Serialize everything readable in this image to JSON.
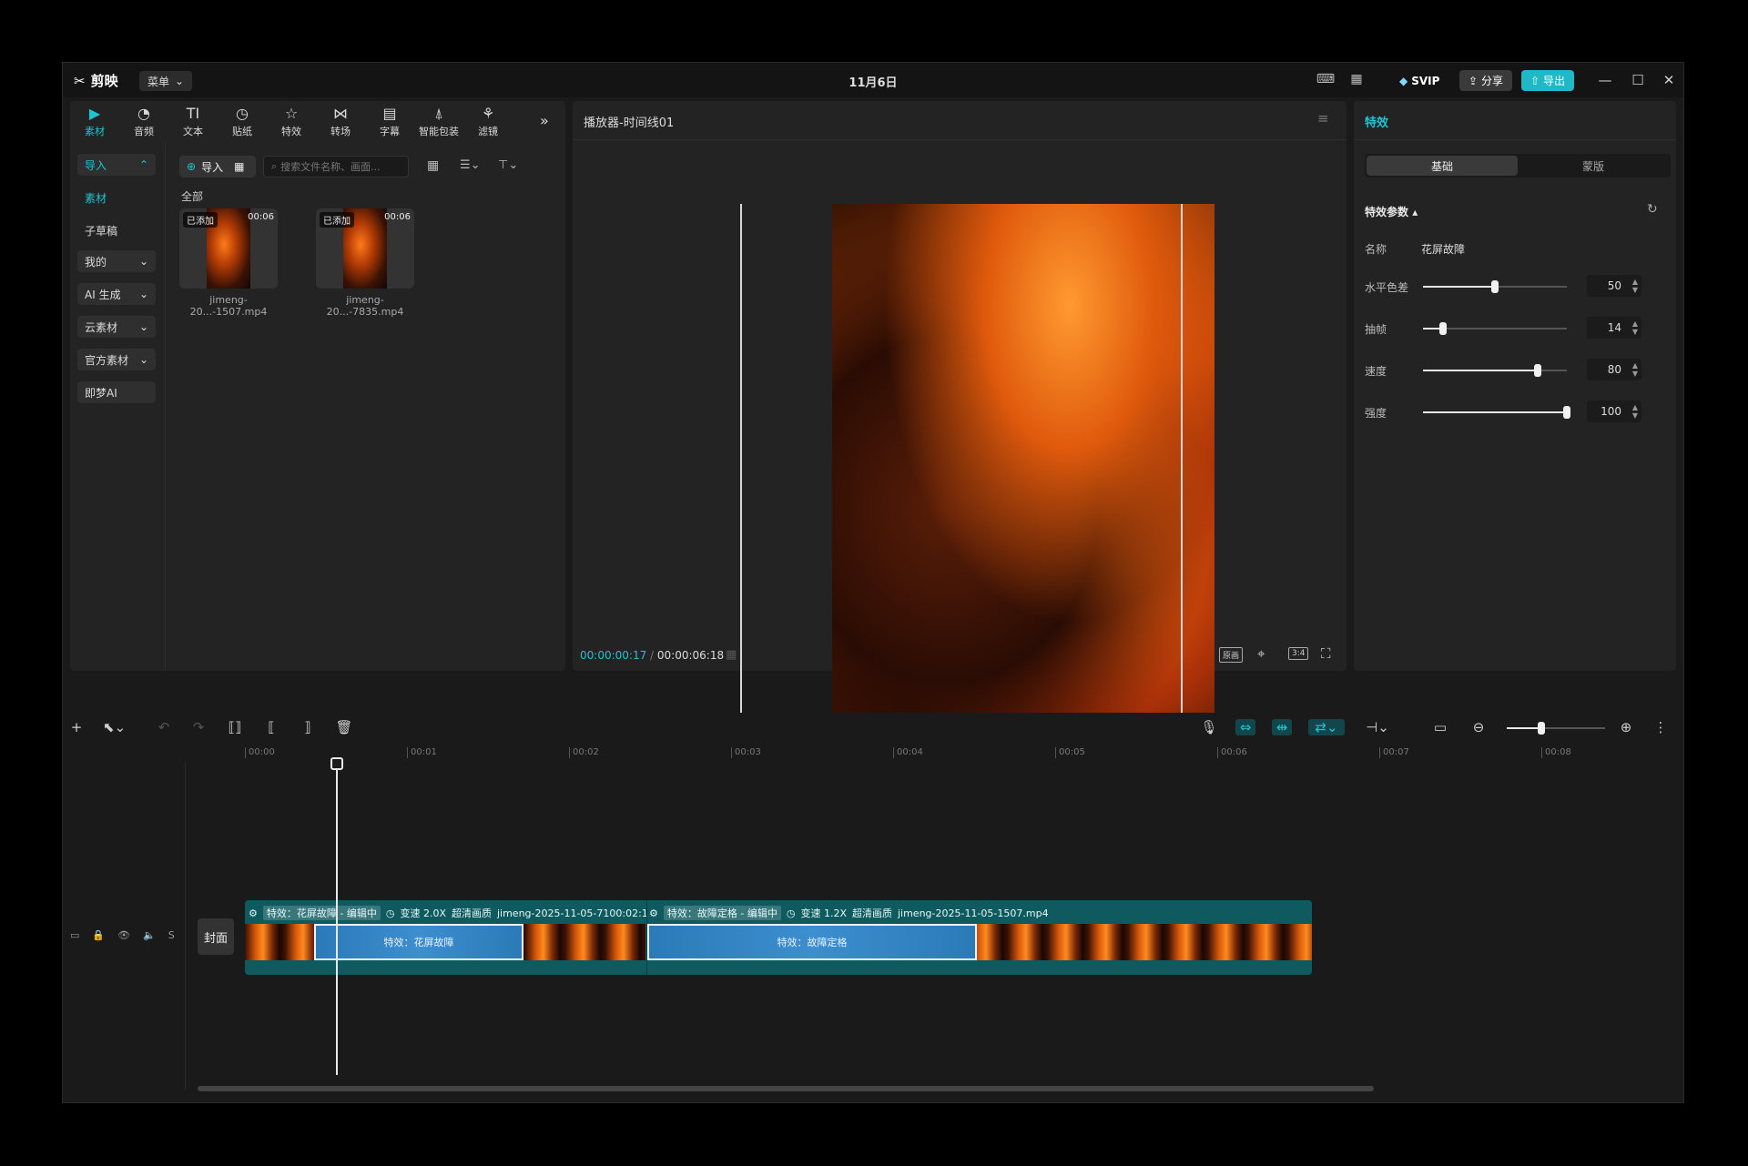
{
  "app": {
    "logo_text": "剪映",
    "menu_label": "菜单",
    "project_title": "11月6日"
  },
  "titlebar": {
    "svip_label": "SVIP",
    "share_label": "分享",
    "export_label": "导出"
  },
  "toolbar": {
    "tools": [
      {
        "label": "素材",
        "icon": "media-icon"
      },
      {
        "label": "音频",
        "icon": "audio-icon"
      },
      {
        "label": "文本",
        "icon": "text-icon"
      },
      {
        "label": "贴纸",
        "icon": "sticker-icon"
      },
      {
        "label": "特效",
        "icon": "effects-icon"
      },
      {
        "label": "转场",
        "icon": "transition-icon"
      },
      {
        "label": "字幕",
        "icon": "subtitle-icon"
      },
      {
        "label": "智能包装",
        "icon": "smart-pack-icon"
      },
      {
        "label": "滤镜",
        "icon": "filter-icon"
      }
    ]
  },
  "sidebar": {
    "items": [
      {
        "label": "导入"
      },
      {
        "label": "素材"
      },
      {
        "label": "子草稿"
      },
      {
        "label": "我的"
      },
      {
        "label": "AI 生成"
      },
      {
        "label": "云素材"
      },
      {
        "label": "官方素材"
      },
      {
        "label": "即梦AI"
      }
    ]
  },
  "media": {
    "import_label": "导入",
    "search_placeholder": "搜索文件名称、画面...",
    "section_title": "全部",
    "items": [
      {
        "badge": "已添加",
        "duration": "00:06",
        "name": "jimeng-20...-1507.mp4"
      },
      {
        "badge": "已添加",
        "duration": "00:06",
        "name": "jimeng-20...-7835.mp4"
      }
    ]
  },
  "player": {
    "title": "播放器-时间线01",
    "current_time": "00:00:00:17",
    "total_time": "00:00:06:18",
    "ratio_label": "3:4",
    "original_label": "原画"
  },
  "inspector": {
    "title": "特效",
    "tabs": [
      "基础",
      "蒙版"
    ],
    "section_title": "特效参数",
    "name_label": "名称",
    "name_value": "花屏故障",
    "params": [
      {
        "label": "水平色差",
        "value": 50,
        "max": 100
      },
      {
        "label": "抽帧",
        "value": 14,
        "max": 100
      },
      {
        "label": "速度",
        "value": 80,
        "max": 100
      },
      {
        "label": "强度",
        "value": 100,
        "max": 100
      }
    ]
  },
  "timeline": {
    "ruler": [
      "00:00",
      "00:01",
      "00:02",
      "00:03",
      "00:04",
      "00:05",
      "00:06",
      "00:07",
      "00:08"
    ],
    "cover_label": "封面",
    "track_label": "S",
    "clips": [
      {
        "effect": "特效：花屏故障 - 编辑中",
        "speed": "变速 2.0X",
        "quality": "超清画质",
        "file": "jimeng-2025-11-05-7100:02:1",
        "fx_text": "特效：花屏故障"
      },
      {
        "effect": "特效：故障定格 - 编辑中",
        "speed": "变速 1.2X",
        "quality": "超清画质",
        "file": "jimeng-2025-11-05-1507.mp4",
        "fx_text": "特效：故障定格"
      }
    ]
  },
  "colors": {
    "accent": "#1fc3d2",
    "track": "#0e5a5e",
    "fx": "#3d8ecf"
  }
}
